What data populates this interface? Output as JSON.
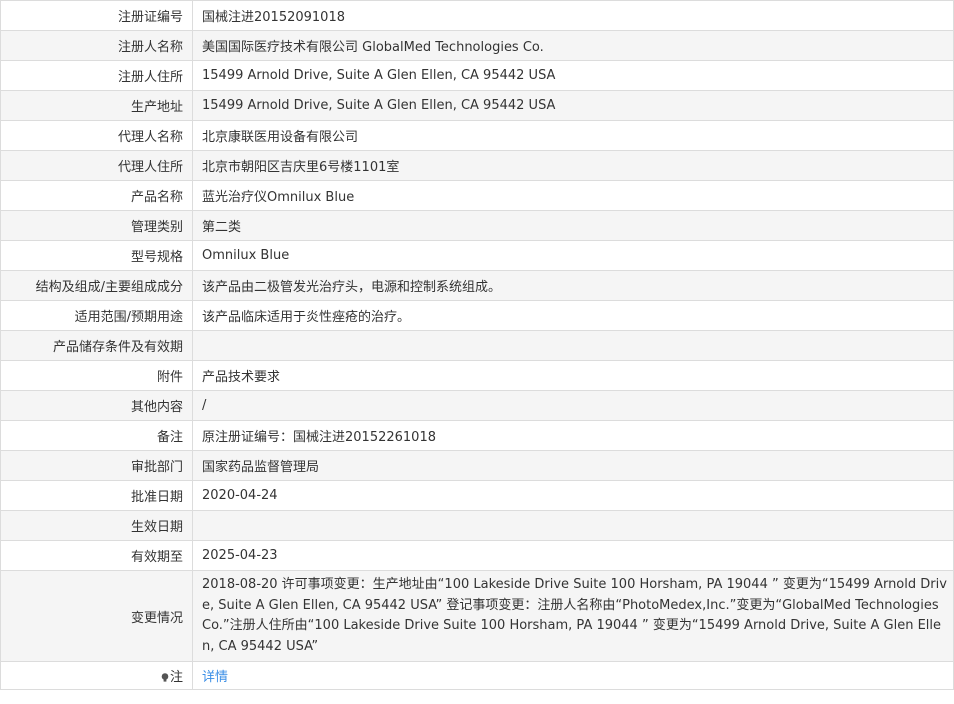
{
  "rows": [
    {
      "label": "注册证编号",
      "value": "国械注进20152091018"
    },
    {
      "label": "注册人名称",
      "value": "美国国际医疗技术有限公司 GlobalMed Technologies Co."
    },
    {
      "label": "注册人住所",
      "value": "15499 Arnold Drive, Suite A Glen Ellen, CA 95442 USA"
    },
    {
      "label": "生产地址",
      "value": "15499 Arnold Drive, Suite A Glen Ellen, CA 95442 USA"
    },
    {
      "label": "代理人名称",
      "value": "北京康联医用设备有限公司"
    },
    {
      "label": "代理人住所",
      "value": "北京市朝阳区吉庆里6号楼1101室"
    },
    {
      "label": "产品名称",
      "value": "蓝光治疗仪Omnilux Blue"
    },
    {
      "label": "管理类别",
      "value": "第二类"
    },
    {
      "label": "型号规格",
      "value": "Omnilux Blue"
    },
    {
      "label": "结构及组成/主要组成成分",
      "value": "该产品由二极管发光治疗头，电源和控制系统组成。"
    },
    {
      "label": "适用范围/预期用途",
      "value": "该产品临床适用于炎性痤疮的治疗。"
    },
    {
      "label": "产品储存条件及有效期",
      "value": ""
    },
    {
      "label": "附件",
      "value": "产品技术要求"
    },
    {
      "label": "其他内容",
      "value": "/"
    },
    {
      "label": "备注",
      "value": "原注册证编号：国械注进20152261018"
    },
    {
      "label": "审批部门",
      "value": "国家药品监督管理局"
    },
    {
      "label": "批准日期",
      "value": "2020-04-24"
    },
    {
      "label": "生效日期",
      "value": ""
    },
    {
      "label": "有效期至",
      "value": "2025-04-23"
    }
  ],
  "change": {
    "label": "变更情况",
    "value": "2018-08-20 许可事项变更：生产地址由“100 Lakeside Drive Suite 100 Horsham, PA 19044 ” 变更为“15499 Arnold Drive, Suite A Glen Ellen, CA 95442 USA” 登记事项变更：注册人名称由“PhotoMedex,Inc.”变更为“GlobalMed Technologies Co.”注册人住所由“100 Lakeside Drive Suite 100 Horsham, PA 19044 ” 变更为“15499 Arnold Drive, Suite A Glen Ellen, CA 95442 USA”"
  },
  "note": {
    "label": "注",
    "icon": "lightbulb-icon",
    "link_text": "详情",
    "link_color": "#3a8ee6"
  }
}
